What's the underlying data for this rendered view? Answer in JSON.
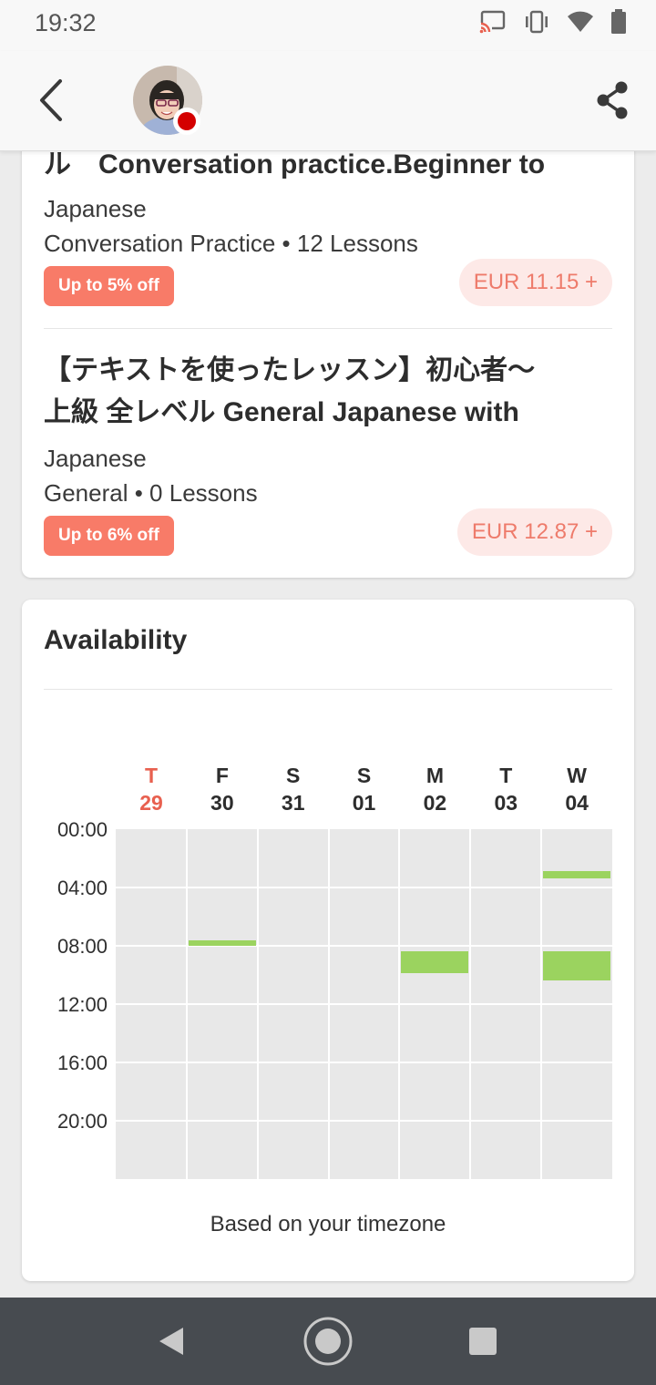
{
  "status_bar": {
    "time": "19:32",
    "icons": [
      "cast-icon",
      "vibrate-icon",
      "wifi-icon",
      "battery-icon"
    ]
  },
  "app_bar": {
    "back_icon": "chevron-left-icon",
    "share_icon": "share-icon",
    "live_indicator_color": "#d40000"
  },
  "courses": [
    {
      "title_line1": "ル　Conversation practice.Beginner to",
      "language": "Japanese",
      "meta": "Conversation Practice • 12 Lessons",
      "discount": "Up to 5% off",
      "price": "EUR 11.15 +"
    },
    {
      "title_line1": "【テキストを使ったレッスン】初心者〜",
      "title_line2": "上級 全レベル General Japanese with",
      "language": "Japanese",
      "meta": "General • 0 Lessons",
      "discount": "Up to 6% off",
      "price": "EUR 12.87 +"
    }
  ],
  "availability": {
    "title": "Availability",
    "days": [
      {
        "weekday": "T",
        "date": "29",
        "today": true
      },
      {
        "weekday": "F",
        "date": "30",
        "today": false
      },
      {
        "weekday": "S",
        "date": "31",
        "today": false
      },
      {
        "weekday": "S",
        "date": "01",
        "today": false
      },
      {
        "weekday": "M",
        "date": "02",
        "today": false
      },
      {
        "weekday": "T",
        "date": "03",
        "today": false
      },
      {
        "weekday": "W",
        "date": "04",
        "today": false
      }
    ],
    "time_labels": [
      "00:00",
      "04:00",
      "08:00",
      "12:00",
      "16:00",
      "20:00"
    ],
    "slots": [
      {
        "day_index": 1,
        "start_hour": 7.6,
        "end_hour": 8.0
      },
      {
        "day_index": 4,
        "start_hour": 8.4,
        "end_hour": 9.9
      },
      {
        "day_index": 6,
        "start_hour": 2.9,
        "end_hour": 3.4
      },
      {
        "day_index": 6,
        "start_hour": 8.4,
        "end_hour": 10.4
      }
    ],
    "footnote": "Based on your timezone"
  },
  "colors": {
    "accent": "#f87b68",
    "today": "#e8604f",
    "available_slot": "#9bd35f",
    "price_bg": "#fde9e7",
    "nav_bar": "#474b50"
  },
  "nav_bar": {
    "icons": [
      "back-triangle-icon",
      "home-circle-icon",
      "recents-square-icon"
    ]
  }
}
